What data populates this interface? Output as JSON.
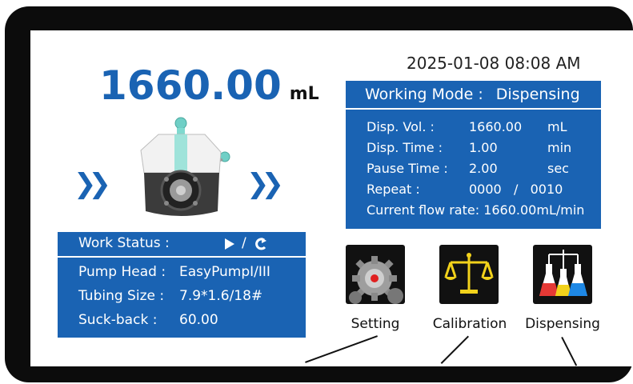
{
  "datetime": "2025-01-08 08:08 AM",
  "volume": {
    "value": "1660.00",
    "unit": "mL"
  },
  "mode": {
    "label": "Working Mode :",
    "value": "Dispensing",
    "rows": [
      {
        "key": "Disp. Vol. :",
        "value": "1660.00",
        "unit": "mL"
      },
      {
        "key": "Disp. Time :",
        "value": "1.00",
        "unit": "min"
      },
      {
        "key": "Pause Time :",
        "value": "2.00",
        "unit": "sec"
      },
      {
        "key": "Repeat :",
        "value": "0000   /   0010",
        "unit": ""
      }
    ],
    "flow_rate": "Current flow rate: 1660.00mL/min"
  },
  "status": {
    "label": "Work Status :",
    "icons": [
      "play-icon",
      "refresh-icon"
    ],
    "separator": "/",
    "rows": [
      {
        "key": "Pump Head :",
        "value": "EasyPumpI/III"
      },
      {
        "key": "Tubing Size :",
        "value": "7.9*1.6/18#"
      },
      {
        "key": "Suck-back :",
        "value": "60.00"
      }
    ]
  },
  "tiles": [
    {
      "label": "Setting",
      "icon": "gear-icon"
    },
    {
      "label": "Calibration",
      "icon": "balance-scale-icon"
    },
    {
      "label": "Dispensing",
      "icon": "flasks-icon"
    }
  ],
  "colors": {
    "accent": "#1a63b3",
    "bezel": "#0c0c0c",
    "screen": "#ffffff"
  }
}
